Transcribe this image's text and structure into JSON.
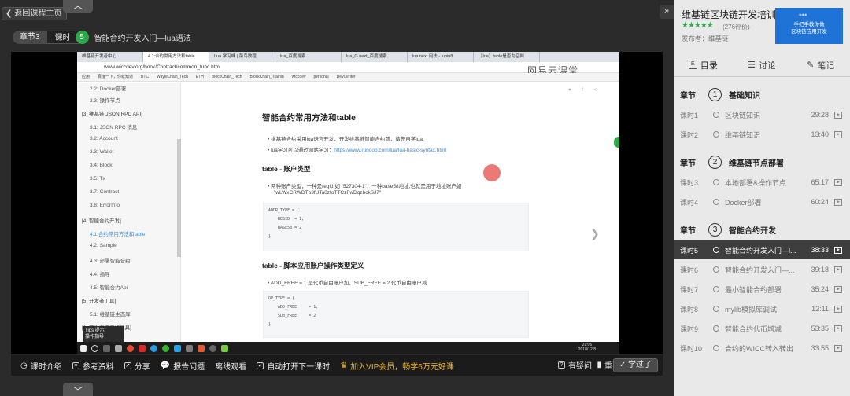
{
  "player": {
    "back_label": "返回课程主页",
    "chapter_label": "章节3",
    "lesson_label": "课时",
    "lesson_num": "5",
    "lesson_title": "智能合约开发入门—lua语法"
  },
  "browser": {
    "tabs": [
      "维基链开发者中心",
      "4.1:合约常用方法和table",
      "Lua 学习峰 | 菜鸟教程",
      "lua_百度搜索",
      "lua_G.next_百度搜索",
      "lua next 用法 - lupin8",
      "【lua】table是否为空判"
    ],
    "address": "www.wiccdev.org/book/Contract/common_func.html",
    "bookmarks": [
      "应用",
      "百度一下，你就知道",
      "BTC",
      "WaykiChain_Tech",
      "ETH",
      "BlockChain_Tech",
      "BlockChain_Trainin",
      "wiccdev",
      "personal",
      "DevCenter"
    ],
    "watermark": "网易云课堂"
  },
  "doc_nav": {
    "items": [
      {
        "t": "2.2: Docker部署",
        "c": ""
      },
      {
        "t": "2.3: 操作节点",
        "c": ""
      },
      {
        "t": "[3. 维基链 JSON RPC API]",
        "c": "sec"
      },
      {
        "t": "3.1: JSON RPC 消息",
        "c": ""
      },
      {
        "t": "3.2: Account",
        "c": ""
      },
      {
        "t": "3.3: Wallet",
        "c": ""
      },
      {
        "t": "3.4: Block",
        "c": ""
      },
      {
        "t": "3.5: Tx",
        "c": ""
      },
      {
        "t": "3.7: Contract",
        "c": ""
      },
      {
        "t": "3.8: ErrorInfo",
        "c": ""
      },
      {
        "t": "[4. 智能合约开发]",
        "c": "sec"
      },
      {
        "t": "4.1:合约常用方法和table",
        "c": "act"
      },
      {
        "t": "4.2: Sample",
        "c": ""
      },
      {
        "t": "4.3: 部署智能合约",
        "c": ""
      },
      {
        "t": "4.4: 指导",
        "c": ""
      },
      {
        "t": "4.5: 智能合约Api",
        "c": ""
      },
      {
        "t": "[5. 开发者工具]",
        "c": "sec"
      },
      {
        "t": "5.1: 维基链生态库",
        "c": ""
      },
      {
        "t": "[6. 开发者资源和工具]",
        "c": "sec"
      }
    ],
    "tips": "Tips 提示\n操作指导"
  },
  "doc": {
    "title": "智能合约常用方法和table",
    "bullet1": "维基链合约采用lua语言开发，开发维基链智能合约前，请先自学lua.",
    "bullet2_prefix": "lua学习可以通过网站学习：",
    "bullet2_link": "https://www.runoob.com/lua/lua-basic-syntax.html",
    "h2_a": "table - 账户类型",
    "bullet3a": "两种账户类型，一种是regid,如 \"527304-1\"，一种base58地址,也就是用于地址账户如",
    "bullet3b": "\"wLWxCRWDTb3fUTa6ztoTTCzFwDqzbckSJ7\"",
    "code1": [
      "ADDR_TYPE = {",
      "    REGID  = 1,",
      "    BASE58 = 2",
      "}"
    ],
    "h2_b": "table - 脚本应用账户操作类型定义",
    "bullet4": "ADD_FREE = 1 是代币自由账户加，SUB_FREE = 2 代币自由账户减",
    "code2": [
      "OP_TYPE = {",
      "    ADD_FREE     = 1,",
      "    SUB_FREE     = 2",
      "}"
    ]
  },
  "taskbar": {
    "time": "21:06",
    "date": "2018/12/8"
  },
  "controls": {
    "intro": "课时介绍",
    "materials": "参考资料",
    "share": "分享",
    "report": "报告问题",
    "offline": "离线观看",
    "autoplay": "自动打开下一课时",
    "vip": "加入VIP会员，畅学6万元好课",
    "ask": "有疑问",
    "note": "重要",
    "learned": "学过了"
  },
  "side": {
    "course_title": "维基链区块链开发培训...",
    "stars": "★★★★★",
    "rating": "(276评价)",
    "publisher": "发布者：维基链",
    "thumb_line1": "手把手教你做",
    "thumb_line2": "区块链应用开发",
    "tabs": [
      "目录",
      "讨论",
      "笔记"
    ],
    "chapters": [
      {
        "label": "章节",
        "num": "1",
        "title": "基础知识"
      },
      {
        "label": "章节",
        "num": "2",
        "title": "维基链节点部署"
      },
      {
        "label": "章节",
        "num": "3",
        "title": "智能合约开发"
      }
    ],
    "lessons": [
      {
        "num": "课时1",
        "title": "区块链知识",
        "dur": "29:28"
      },
      {
        "num": "课时2",
        "title": "维基链知识",
        "dur": "13:40"
      },
      {
        "num": "课时3",
        "title": "本地部署&操作节点",
        "dur": "65:17"
      },
      {
        "num": "课时4",
        "title": "Docker部署",
        "dur": "60:24"
      },
      {
        "num": "课时5",
        "title": "智能合约开发入门—l...",
        "dur": "38:33"
      },
      {
        "num": "课时6",
        "title": "智能合约开发入门—...",
        "dur": "39:18"
      },
      {
        "num": "课时7",
        "title": "最小智能合约部署",
        "dur": "35:24"
      },
      {
        "num": "课时8",
        "title": "mylib模拟库调试",
        "dur": "12:11"
      },
      {
        "num": "课时9",
        "title": "智能合约代币增减",
        "dur": "53:35"
      },
      {
        "num": "课时10",
        "title": "合约的WICC转入转出",
        "dur": "33:55"
      }
    ]
  }
}
